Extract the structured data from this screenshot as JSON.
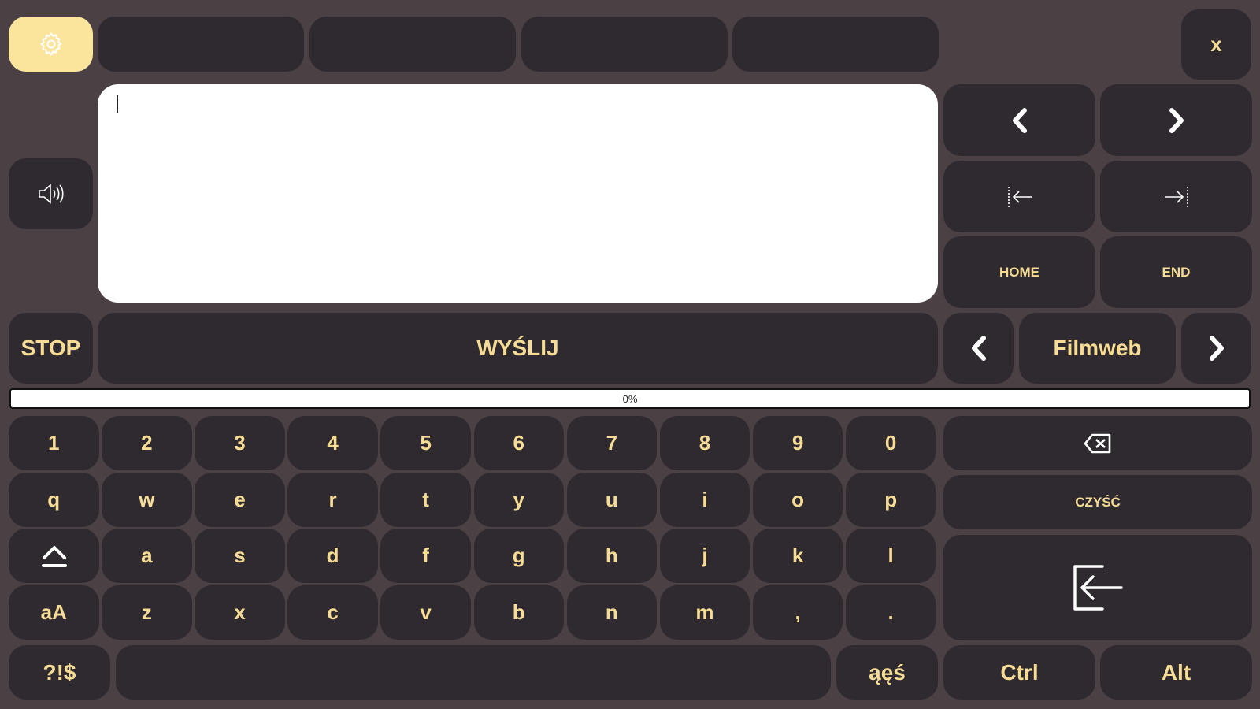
{
  "topbar": {
    "settings_icon": "gear-icon",
    "slots": [
      "",
      "",
      "",
      ""
    ],
    "close_label": "x"
  },
  "speaker_icon": "speaker-icon",
  "editor": {
    "value": ""
  },
  "nav": {
    "prev_icon": "chevron-left-icon",
    "next_icon": "chevron-right-icon",
    "word_left_icon": "arrow-left-bar-icon",
    "word_right_icon": "arrow-right-bar-icon",
    "home_label": "HOME",
    "end_label": "END"
  },
  "actions": {
    "stop_label": "STOP",
    "send_label": "WYŚLIJ",
    "site_label": "Filmweb"
  },
  "progress": {
    "value": 0,
    "label": "0%"
  },
  "keyboard": {
    "row_numbers": [
      "1",
      "2",
      "3",
      "4",
      "5",
      "6",
      "7",
      "8",
      "9",
      "0"
    ],
    "row_top": [
      "q",
      "w",
      "e",
      "r",
      "t",
      "y",
      "u",
      "i",
      "o",
      "p"
    ],
    "row_mid": [
      "a",
      "s",
      "d",
      "f",
      "g",
      "h",
      "j",
      "k",
      "l"
    ],
    "row_bottom": [
      "aA",
      "z",
      "x",
      "c",
      "v",
      "b",
      "n",
      "m",
      ",",
      "."
    ],
    "backspace_icon": "backspace-icon",
    "clear_label": "CZYŚĆ",
    "enter_icon": "enter-icon",
    "shift_icon": "shift-icon",
    "symbols_label": "?!$",
    "space_label": "",
    "diacritics_label": "ąęś",
    "ctrl_label": "Ctrl",
    "alt_label": "Alt"
  },
  "colors": {
    "background": "#4b4145",
    "key": "#2f2a30",
    "accent": "#f6dc95",
    "settings": "#fbe49b"
  }
}
